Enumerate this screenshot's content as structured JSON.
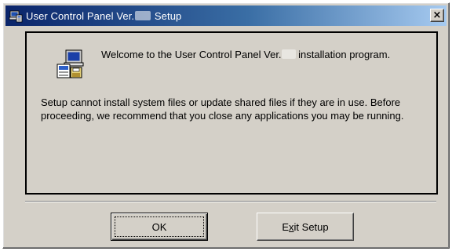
{
  "window": {
    "title_prefix": "User Control Panel Ver.",
    "title_suffix": "Setup",
    "close_glyph": "×",
    "icon": "setup-computer-icon"
  },
  "panel": {
    "icon": "setup-computer-icon",
    "welcome_prefix": "Welcome to the User Control Panel Ver.",
    "welcome_suffix": "installation program.",
    "message": "Setup cannot install system files or update shared files if they are in use. Before proceeding, we recommend that you close any applications you may be running."
  },
  "buttons": {
    "ok_label": "OK",
    "exit_label_pre": "E",
    "exit_label_mnemonic": "x",
    "exit_label_post": "it Setup"
  },
  "colors": {
    "titlebar_start": "#0a246a",
    "titlebar_end": "#a6caf0",
    "face": "#d4d0c8"
  }
}
